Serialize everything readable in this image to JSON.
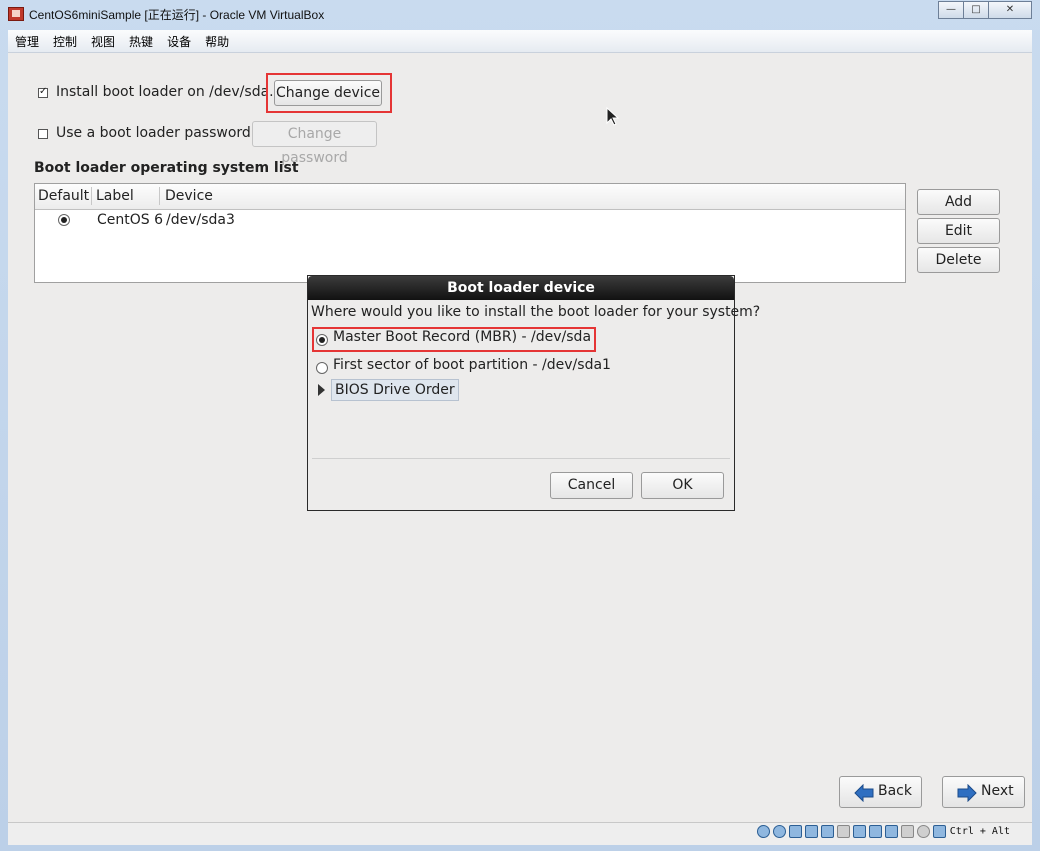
{
  "window": {
    "title": "CentOS6miniSample [正在运行] - Oracle VM VirtualBox",
    "controls": {
      "minimize": "—",
      "maximize": "□",
      "close": "✕"
    }
  },
  "menubar": {
    "items": [
      "管理",
      "控制",
      "视图",
      "热键",
      "设备",
      "帮助"
    ]
  },
  "installer": {
    "install_bootloader_label": "Install boot loader on /dev/sda.",
    "install_bootloader_checked": true,
    "change_device_label": "Change device",
    "use_password_label": "Use a boot loader password",
    "use_password_checked": false,
    "change_password_label": "Change password",
    "os_list_heading": "Boot loader operating system list",
    "os_list_columns": [
      "Default",
      "Label",
      "Device"
    ],
    "os_list_rows": [
      {
        "default": true,
        "label": "CentOS 6",
        "device": "/dev/sda3"
      }
    ],
    "side_buttons": {
      "add": "Add",
      "edit": "Edit",
      "delete": "Delete"
    },
    "nav": {
      "back": "Back",
      "next": "Next"
    }
  },
  "dialog": {
    "title": "Boot loader device",
    "question": "Where would you like to install the boot loader for your system?",
    "options": [
      {
        "label": "Master Boot Record (MBR) - /dev/sda",
        "selected": true
      },
      {
        "label": "First sector of boot partition - /dev/sda1",
        "selected": false
      }
    ],
    "expander_label": "BIOS Drive Order",
    "cancel_label": "Cancel",
    "ok_label": "OK"
  },
  "statusbar": {
    "hostkey_text": "Ctrl + Alt"
  },
  "colors": {
    "highlight": "#e53535",
    "dialog_title_bg": "#1a1a1a",
    "arrow_blue": "#2f6fc1"
  }
}
